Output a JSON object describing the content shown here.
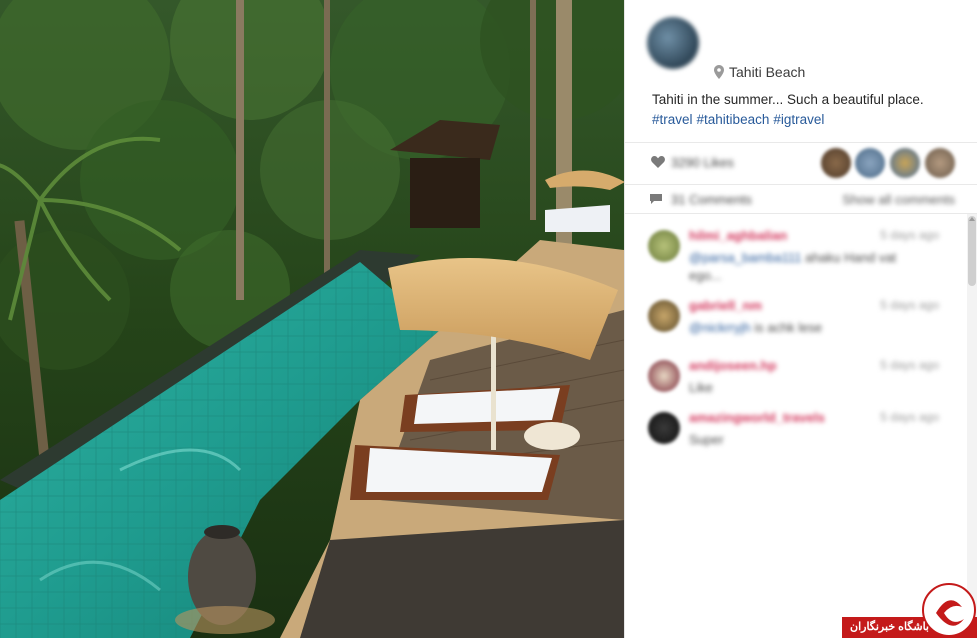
{
  "post": {
    "location": "Tahiti Beach",
    "caption_text": "Tahiti in the summer... Such a beautiful place.",
    "hashtags": [
      "#travel",
      "#tahitibeach",
      "#igtravel"
    ]
  },
  "stats": {
    "likes_label": "3290 Likes",
    "comments_label": "31 Comments",
    "show_all_label": "Show all comments"
  },
  "comments": [
    {
      "username": "hilmi_aghbalian",
      "time": "5 days ago",
      "mention": "@parsa_bamba111",
      "text": "ahaku Hand vat ego..."
    },
    {
      "username": "gabriell_nm",
      "time": "5 days ago",
      "mention": "@nickrryjh",
      "text": "is achk lese"
    },
    {
      "username": "andijoseen.hp",
      "time": "5 days ago",
      "mention": "",
      "text": "Like"
    },
    {
      "username": "amazingworld_travels",
      "time": "5 days ago",
      "mention": "",
      "text": "Super"
    }
  ],
  "watermark": {
    "text": "باشگاه خبرنگاران"
  },
  "colors": {
    "username": "#d3365c",
    "link": "#285a9a",
    "watermark": "#c41a1a"
  },
  "icons": [
    "location-pin-icon",
    "heart-icon",
    "comment-bubble-icon",
    "scroll-up-icon",
    "logo-icon"
  ]
}
